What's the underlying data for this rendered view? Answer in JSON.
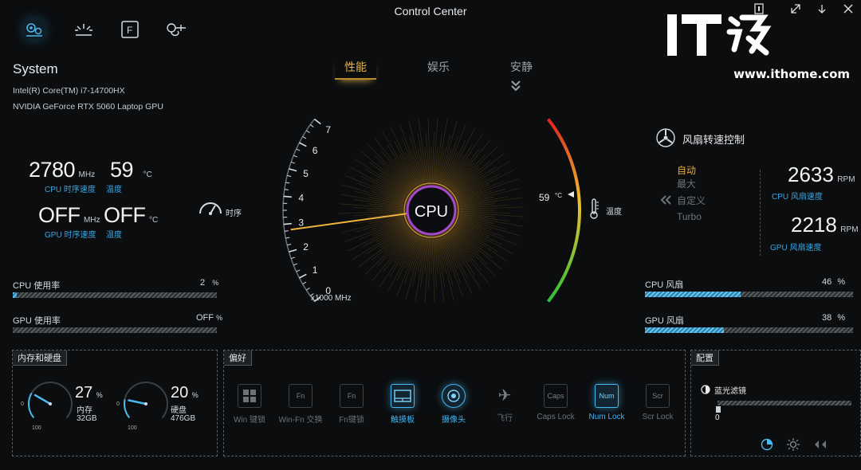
{
  "window": {
    "title": "Control Center"
  },
  "watermark": {
    "logo": "IT之家",
    "url": "www.ithome.com"
  },
  "mode_tabs": [
    {
      "label": "性能",
      "active": true
    },
    {
      "label": "娱乐",
      "active": false
    },
    {
      "label": "安静",
      "active": false
    }
  ],
  "system": {
    "title": "System",
    "cpu_name": "Intel(R) Core(TM) i7-14700HX",
    "gpu_name": "NVIDIA GeForce RTX 5060 Laptop GPU",
    "cpu_clock": {
      "value": "2780",
      "unit": "MHz",
      "label": "CPU 时序速度"
    },
    "cpu_temp": {
      "value": "59",
      "unit": "°C",
      "label": "温度"
    },
    "gpu_clock": {
      "value": "OFF",
      "unit": "MHz",
      "label": "GPU 时序速度"
    },
    "gpu_temp": {
      "value": "OFF",
      "unit": "°C",
      "label": "温度"
    },
    "clock_icon_label": "时序",
    "cpu_usage": {
      "label": "CPU 使用率",
      "value": "2",
      "unit": "%",
      "level": 0.02
    },
    "gpu_usage": {
      "label": "GPU 使用率",
      "value": "OFF",
      "unit": "%",
      "level": 0
    }
  },
  "gauge": {
    "center_label": "CPU",
    "ticks": [
      "0",
      "1",
      "2",
      "3",
      "4",
      "5",
      "6",
      "7"
    ],
    "scale_label": "x1000 MHz",
    "needle_value": 2.78,
    "temp_value": "59",
    "temp_unit": "°C",
    "temp_label": "温度"
  },
  "fan": {
    "title": "风扇转速控制",
    "modes": [
      {
        "label": "自动",
        "active": true
      },
      {
        "label": "最大",
        "active": false
      },
      {
        "label": "自定义",
        "active": false
      },
      {
        "label": "Turbo",
        "active": false
      }
    ],
    "cpu_rpm": {
      "value": "2633",
      "unit": "RPM",
      "label": "CPU 风扇速度"
    },
    "gpu_rpm": {
      "value": "2218",
      "unit": "RPM",
      "label": "GPU 风扇速度"
    },
    "cpu_fan": {
      "label": "CPU 风扇",
      "value": "46",
      "unit": "%",
      "level": 0.46
    },
    "gpu_fan": {
      "label": "GPU 风扇",
      "value": "38",
      "unit": "%",
      "level": 0.38
    }
  },
  "memory_panel": {
    "title": "内存和硬盘",
    "memory": {
      "value": "27",
      "unit": "%",
      "label": "内存",
      "size": "32GB",
      "level": 0.27,
      "min": "0",
      "max": "100"
    },
    "disk": {
      "value": "20",
      "unit": "%",
      "label": "硬盘",
      "size": "476GB",
      "level": 0.2,
      "min": "0",
      "max": "100"
    }
  },
  "prefs_panel": {
    "title": "偏好",
    "items": [
      {
        "label": "Win 键锁",
        "glyph": "",
        "on": false
      },
      {
        "label": "Win-Fn 交换",
        "glyph": "Fn",
        "on": false
      },
      {
        "label": "Fn键锁",
        "glyph": "Fn",
        "on": false
      },
      {
        "label": "触摸板",
        "glyph": "",
        "on": true
      },
      {
        "label": "摄像头",
        "glyph": "",
        "on": true
      },
      {
        "label": "飞行",
        "glyph": "✈",
        "on": false
      },
      {
        "label": "Caps Lock",
        "glyph": "Caps",
        "on": false
      },
      {
        "label": "Num Lock",
        "glyph": "Num",
        "on": true
      },
      {
        "label": "Scr Lock",
        "glyph": "Scr",
        "on": false
      }
    ]
  },
  "config_panel": {
    "title": "配置",
    "blue_light_label": "蓝光滤镜",
    "blue_light_value": "0",
    "blue_light_level": 0
  },
  "colors": {
    "accent_blue": "#3aa7e6",
    "accent_gold": "#e7b34a",
    "bg": "#0b0d0f"
  }
}
